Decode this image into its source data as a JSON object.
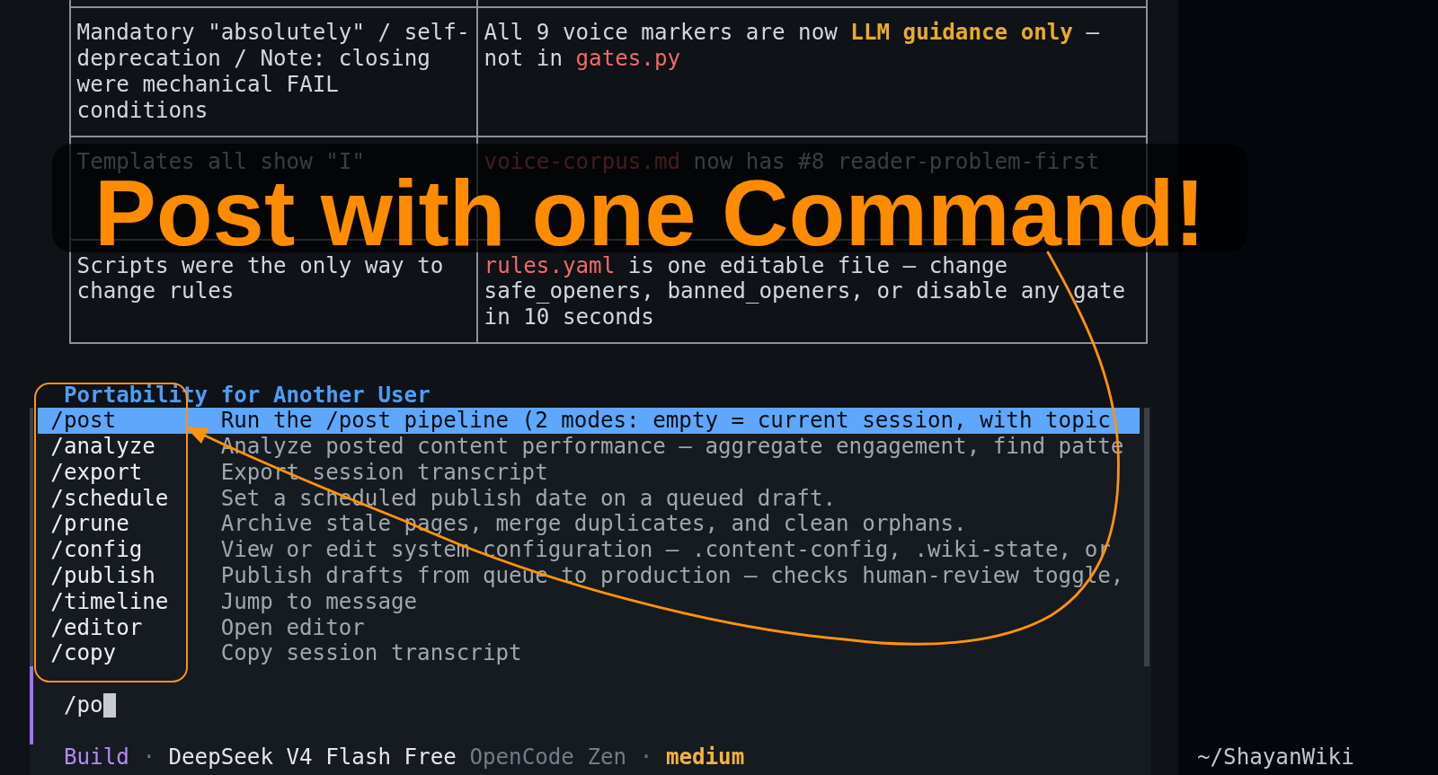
{
  "table": {
    "rows": [
      {
        "cells": [
          {
            "segments": [
              {
                "kind": "plain",
                "text": "Mandatory \"absolutely\" / self-deprecation / Note: closing were mechanical FAIL conditions"
              }
            ]
          },
          {
            "segments": [
              {
                "kind": "plain",
                "text": "All 9 voice markers are now "
              },
              {
                "kind": "emphasis",
                "text": "LLM guidance only"
              },
              {
                "kind": "plain",
                "text": " — not in "
              },
              {
                "kind": "code",
                "text": "gates.py"
              }
            ]
          }
        ]
      },
      {
        "cells": [
          {
            "segments": [
              {
                "kind": "plain",
                "text": "Templates all show \"I\""
              }
            ]
          },
          {
            "segments": [
              {
                "kind": "code",
                "text": "voice-corpus.md"
              },
              {
                "kind": "plain",
                "text": " now has #8 reader-problem-first"
              }
            ]
          }
        ]
      },
      {
        "cells": [
          {
            "segments": [
              {
                "kind": "plain",
                "text": "Scripts were the only way to change rules"
              }
            ]
          },
          {
            "segments": [
              {
                "kind": "code",
                "text": "rules.yaml"
              },
              {
                "kind": "plain",
                "text": " is one editable file — change safe_openers, banned_openers, or disable any gate in 10 seconds"
              }
            ]
          }
        ]
      }
    ]
  },
  "section_heading": "Portability for Another User",
  "commands": [
    {
      "name": "/post",
      "description": "Run the /post pipeline (2 modes: empty = current session, with topic",
      "selected": true
    },
    {
      "name": "/analyze",
      "description": "Analyze posted content performance — aggregate engagement, find patte",
      "selected": false
    },
    {
      "name": "/export",
      "description": "Export session transcript",
      "selected": false
    },
    {
      "name": "/schedule",
      "description": "Set a scheduled publish date on a queued draft.",
      "selected": false
    },
    {
      "name": "/prune",
      "description": "Archive stale pages, merge duplicates, and clean orphans.",
      "selected": false
    },
    {
      "name": "/config",
      "description": "View or edit system configuration — .content-config, .wiki-state, or",
      "selected": false
    },
    {
      "name": "/publish",
      "description": "Publish drafts from queue to production — checks human-review toggle,",
      "selected": false
    },
    {
      "name": "/timeline",
      "description": "Jump to message",
      "selected": false
    },
    {
      "name": "/editor",
      "description": "Open editor",
      "selected": false
    },
    {
      "name": "/copy",
      "description": "Copy session transcript",
      "selected": false
    }
  ],
  "input": {
    "value": "/po"
  },
  "status_bar": {
    "segments": [
      {
        "kind": "mode",
        "text": "Build"
      },
      {
        "kind": "separator",
        "text": "·"
      },
      {
        "kind": "model",
        "text": "DeepSeek V4 Flash Free"
      },
      {
        "kind": "provider",
        "text": "OpenCode Zen"
      },
      {
        "kind": "separator",
        "text": "·"
      },
      {
        "kind": "variant",
        "text": "medium"
      }
    ],
    "path": "~/ShayanWiki"
  },
  "overlay": {
    "caption": "Post with one Command!"
  }
}
